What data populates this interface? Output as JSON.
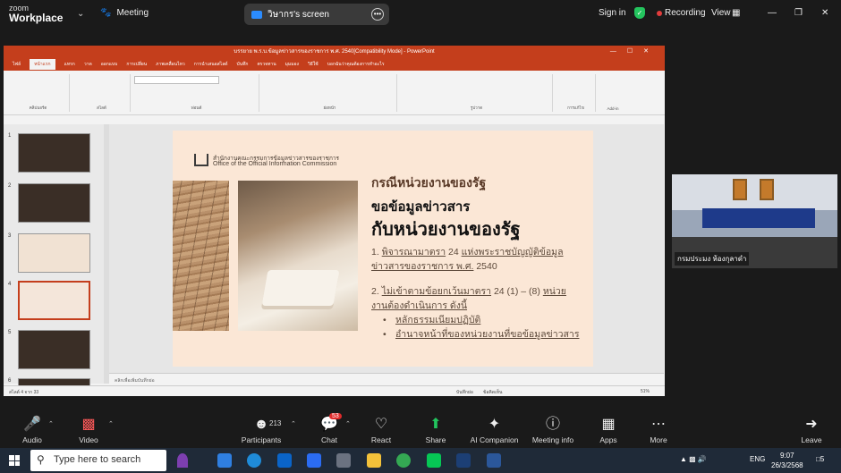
{
  "zoom": {
    "logo_line1": "zoom",
    "logo_line2": "Workplace",
    "meeting_label": "Meeting",
    "screen_share_label": "วิษากร's screen",
    "sign_in": "Sign in",
    "recording": "Recording",
    "view": "View"
  },
  "ppt": {
    "window_title": "บรรยาย พ.ร.บ.ข้อมูลข่าวสารของราชการ พ.ศ. 2540[Compatibility Mode] - PowerPoint",
    "tabs": [
      "ไฟล์",
      "หน้าแรก",
      "แทรก",
      "วาด",
      "ออกแบบ",
      "การเปลี่ยน",
      "ภาพเคลื่อนไหว",
      "การนำเสนอสไลด์",
      "บันทึก",
      "ตรวจทาน",
      "มุมมอง",
      "วิธีใช้",
      "บอกฉันว่าคุณต้องการทำอะไร"
    ],
    "active_tab_index": 1,
    "ribbon_groups": [
      "คลิปบอร์ด",
      "สไลด์",
      "ฟอนต์",
      "ย่อหน้า",
      "รูปวาด",
      "การแก้ไข",
      "Add-in"
    ],
    "thumbnail_numbers": [
      "1",
      "2",
      "3",
      "4",
      "5",
      "6"
    ],
    "selected_thumbnail": 4,
    "notes_placeholder": "คลิกเพื่อเพิ่มบันทึกย่อ",
    "status_left": "สไลด์ 4 จาก 33",
    "status_notes": "บันทึกย่อ",
    "status_comments": "ข้อคิดเห็น",
    "zoom_level": "51%"
  },
  "slide": {
    "org_th": "สำนักงานคณะกรรมการข้อมูลข่าวสารของราชการ",
    "org_en": "Office of the Official Information Commission",
    "heading_small": "กรณีหน่วยงานของรัฐ",
    "heading_mid": "ขอข้อมูลข่าวสาร",
    "heading_big": "กับหน่วยงานของรัฐ",
    "point1_prefix": "1. ",
    "point1_underlined": "พิจารณามาตรา",
    "point1_rest": " 24 ",
    "point1_underlined2": "แห่งพระราชบัญญัติข้อมูลข่าวสารของราชการ พ.ศ.",
    "point1_year": " 2540",
    "point2_prefix": "2. ",
    "point2_underlined": "ไม่เข้าตามข้อยกเว้นมาตรา",
    "point2_rest": " 24 (1) – (8) ",
    "point2_underlined2": "หน่วยงานต้องดำเนินการ ดังนี้",
    "bullets": [
      "หลักธรรมเนียมปฏิบัติ",
      "อำนาจหน้าที่ของหน่วยงานที่ขอข้อมูลข่าวสาร"
    ]
  },
  "video": {
    "participant_name": "กรมประมง ห้องกุลาดำ"
  },
  "toolbar": {
    "audio": "Audio",
    "video": "Video",
    "participants": "Participants",
    "participant_count": "213",
    "chat": "Chat",
    "chat_badge": "53",
    "react": "React",
    "share": "Share",
    "ai_companion": "AI Companion",
    "meeting_info": "Meeting info",
    "apps": "Apps",
    "more": "More",
    "leave": "Leave"
  },
  "taskbar": {
    "search_placeholder": "Type here to search",
    "language": "ENG",
    "time": "9:07",
    "date": "26/3/2568",
    "notification_count": "5"
  },
  "colors": {
    "ppt_accent": "#c43e1c",
    "zoom_bg": "#1a1a1a",
    "share_green": "#22c55e",
    "slide_bg": "#fbe7d6"
  }
}
